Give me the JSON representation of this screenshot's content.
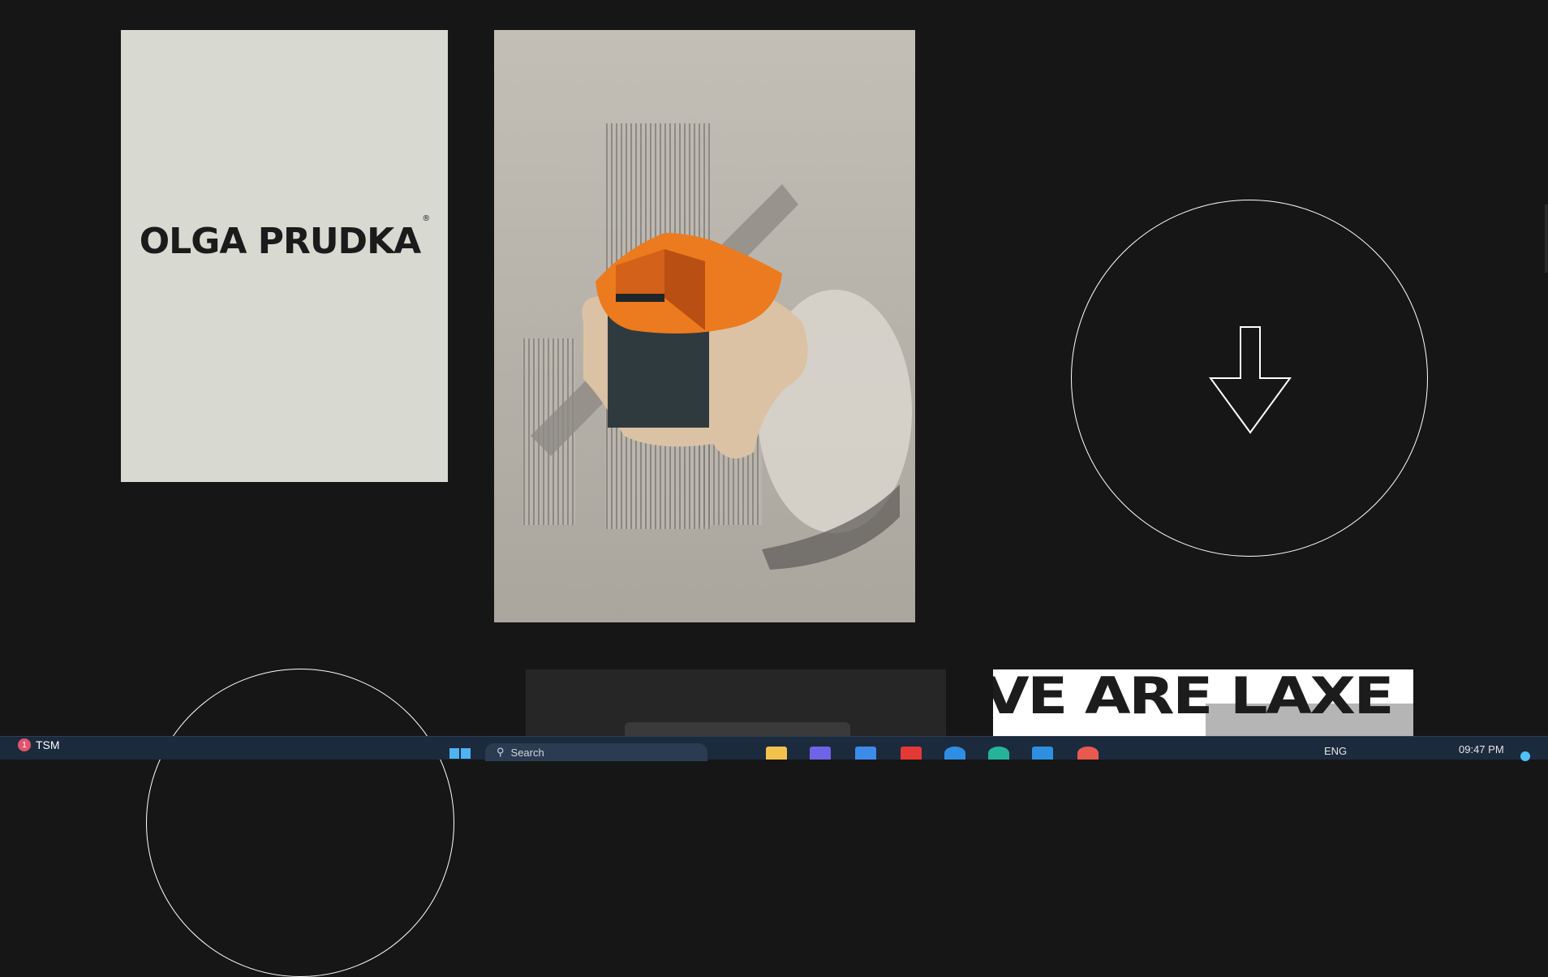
{
  "gallery": {
    "logo_card": {
      "text": "OLGA PRUDKA",
      "mark": "®",
      "bg": "#d8d9d1"
    },
    "art_card": {
      "description_icon": "abstract-sculpture-art",
      "accent": "#ec7a1f"
    },
    "scroll_button": {
      "icon": "arrow-down-icon"
    },
    "laxe_card": {
      "text": "VE ARE LAXE"
    }
  },
  "taskbar": {
    "notification_count": "1",
    "account_label": "TSM",
    "search_placeholder": "Search",
    "language": "ENG",
    "time": "09:47 PM",
    "colors": {
      "bar": "#1c2a3d",
      "start": "#4fb3f2"
    }
  }
}
